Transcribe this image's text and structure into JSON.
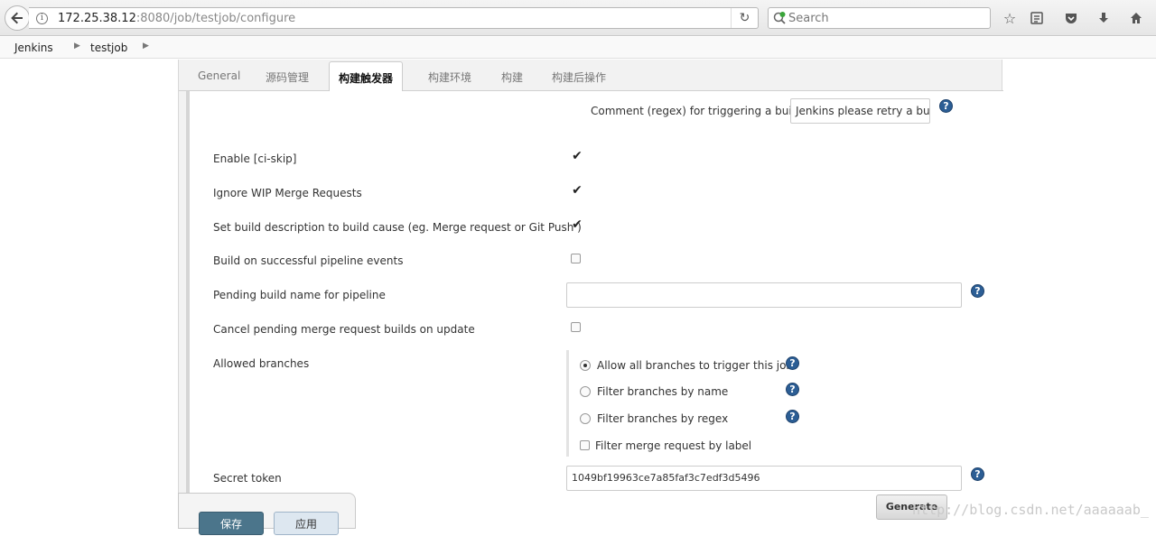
{
  "browser": {
    "url_host": "172.25.38.12",
    "url_rest": ":8080/job/testjob/configure",
    "search_placeholder": "Search"
  },
  "breadcrumb": [
    "Jenkins",
    "testjob"
  ],
  "tabs": [
    "General",
    "源码管理",
    "构建触发器",
    "构建环境",
    "构建",
    "构建后操作"
  ],
  "form": {
    "comment_label": "Comment (regex) for triggering a build",
    "comment_value": "Jenkins please retry a bui",
    "ci_skip_label": "Enable [ci-skip]",
    "ci_skip_checked": true,
    "wip_label": "Ignore WIP Merge Requests",
    "wip_checked": true,
    "desc_label": "Set build description to build cause (eg. Merge request or Git Push )",
    "desc_checked": true,
    "pipeline_label": "Build on successful pipeline events",
    "pipeline_checked": false,
    "pending_label": "Pending build name for pipeline",
    "pending_value": "",
    "cancel_label": "Cancel pending merge request builds on update",
    "cancel_checked": false,
    "branches_label": "Allowed branches",
    "branch_options": [
      {
        "label": "Allow all branches to trigger this job",
        "selected": true
      },
      {
        "label": "Filter branches by name",
        "selected": false
      },
      {
        "label": "Filter branches by regex",
        "selected": false
      }
    ],
    "filter_label": "Filter merge request by label",
    "filter_checked": false,
    "secret_label": "Secret token",
    "secret_value": "1049bf19963ce7a85faf3c7edf3d5496",
    "generate_label": "Generate"
  },
  "actions": {
    "save_label": "保存",
    "apply_label": "应用"
  },
  "watermark": "http://blog.csdn.net/aaaaaab_"
}
